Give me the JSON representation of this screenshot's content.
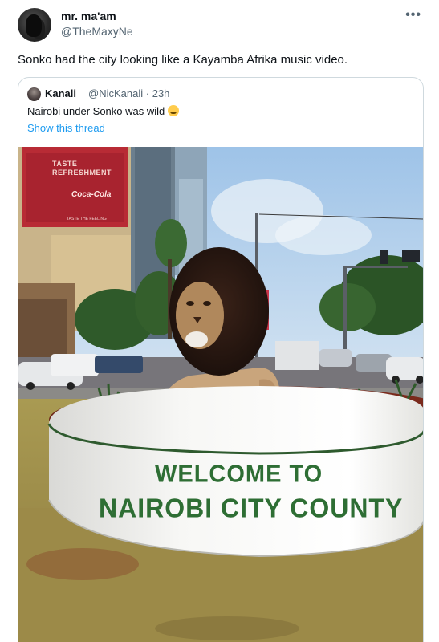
{
  "author": {
    "display_name": "mr. ma'am",
    "handle": "@TheMaxyNe"
  },
  "more_icon": "more-horizontal-icon",
  "tweet_text": "Sonko had the city looking like a Kayamba Afrika music video.",
  "quoted_tweet": {
    "display_name": "Kanali",
    "handle": "@NicKanali",
    "separator": "·",
    "time": "23h",
    "text": "Nairobi under Sonko was wild",
    "emoji": "grinning-sweat-emoji",
    "show_thread_label": "Show this thread"
  },
  "photo": {
    "billboard_line1": "TASTE",
    "billboard_line2": "REFRESHMENT",
    "billboard_brand": "Coca-Cola",
    "billboard_small": "TASTE THE FEELING",
    "sign_line1": "WELCOME TO",
    "sign_line2": "NAIROBI CITY COUNTY"
  },
  "colors": {
    "link": "#1d9bf0",
    "secondary_text": "#536471",
    "sign_green": "#2e6e34",
    "border": "#cfd9de"
  }
}
